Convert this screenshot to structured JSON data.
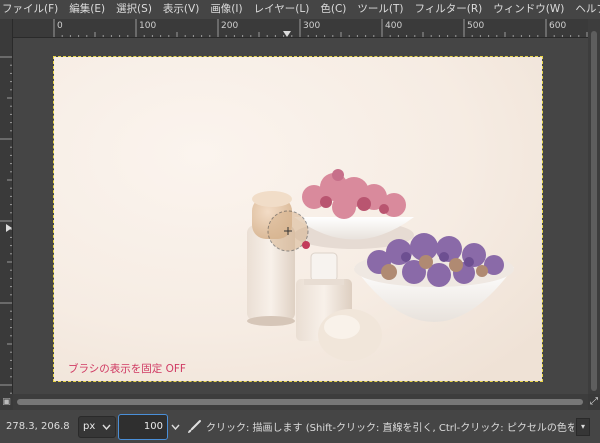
{
  "menubar": {
    "items": [
      {
        "label": "ファイル(F)"
      },
      {
        "label": "編集(E)"
      },
      {
        "label": "選択(S)"
      },
      {
        "label": "表示(V)"
      },
      {
        "label": "画像(I)"
      },
      {
        "label": "レイヤー(L)"
      },
      {
        "label": "色(C)"
      },
      {
        "label": "ツール(T)"
      },
      {
        "label": "フィルター(R)"
      },
      {
        "label": "ウィンドウ(W)"
      },
      {
        "label": "ヘルプ(H)"
      }
    ]
  },
  "ruler": {
    "labels": [
      "0",
      "100",
      "200",
      "300",
      "400",
      "500",
      "600"
    ]
  },
  "canvas": {
    "overlay_text": "ブラシの表示を固定 OFF",
    "overlay_color": "#d03a63",
    "selection_border_color": "#e8d54a"
  },
  "statusbar": {
    "coords": "278.3, 206.8",
    "unit": "px",
    "zoom_value": "100",
    "message": "クリック: 描画します (Shift-クリック: 直線を引く, Ctrl-クリック: ピクセルの色を描画色..."
  },
  "icons": {
    "unit_dropdown": "chevron-down-icon",
    "zoom_dropdown": "chevron-down-icon",
    "tool": "paintbrush-icon",
    "navigate": "navigate-icon",
    "zoom_toggle": "zoom-icon"
  }
}
